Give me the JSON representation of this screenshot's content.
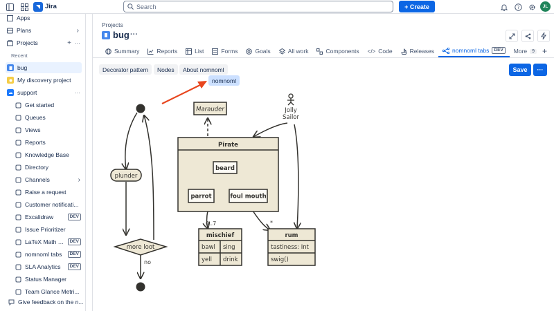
{
  "topbar": {
    "app_name": "Jira",
    "search_placeholder": "Search",
    "create_label": "+ Create",
    "avatar": "JL"
  },
  "sidebar": {
    "top": [
      {
        "label": "Apps"
      },
      {
        "label": "Plans"
      },
      {
        "label": "Projects"
      }
    ],
    "recent_label": "Recent",
    "recent": [
      {
        "label": "bug"
      },
      {
        "label": "My discovery project"
      },
      {
        "label": "support"
      }
    ],
    "items": [
      {
        "label": "Get started"
      },
      {
        "label": "Queues"
      },
      {
        "label": "Views"
      },
      {
        "label": "Reports"
      },
      {
        "label": "Knowledge Base"
      },
      {
        "label": "Directory"
      },
      {
        "label": "Channels"
      },
      {
        "label": "Raise a request"
      },
      {
        "label": "Customer notificati..."
      },
      {
        "label": "Excalidraw",
        "badge": "DEV"
      },
      {
        "label": "Issue Prioritizer"
      },
      {
        "label": "LaTeX Math T...",
        "badge": "DEV"
      },
      {
        "label": "nomnoml tabs",
        "badge": "DEV"
      },
      {
        "label": "SLA Analytics",
        "badge": "DEV"
      },
      {
        "label": "Status Manager"
      },
      {
        "label": "Team Glance Metri..."
      }
    ],
    "feedback": "Give feedback on the n..."
  },
  "header": {
    "breadcrumb": "Projects",
    "title": "bug",
    "more": "···"
  },
  "tabs": [
    {
      "label": "Summary"
    },
    {
      "label": "Reports"
    },
    {
      "label": "List"
    },
    {
      "label": "Forms"
    },
    {
      "label": "Goals"
    },
    {
      "label": "All work"
    },
    {
      "label": "Components"
    },
    {
      "label": "Code"
    },
    {
      "label": "Releases"
    },
    {
      "label": "nomnoml tabs",
      "badge": "DEV"
    },
    {
      "label": "More",
      "count": "9"
    }
  ],
  "subtabs": [
    {
      "label": "Decorator pattern"
    },
    {
      "label": "Nodes"
    },
    {
      "label": "About nomnoml"
    }
  ],
  "tooltip": "nomnoml",
  "toolbar": {
    "save_label": "Save",
    "more": "···"
  },
  "diagram": {
    "marauder": "Marauder",
    "jolly": "Jolly",
    "sailor": "Sailor",
    "pirate": "Pirate",
    "beard": "beard",
    "parrot": "parrot",
    "foul_mouth": "foul mouth",
    "plunder": "plunder",
    "more_loot": "more loot",
    "no": "no",
    "mischief": "mischief",
    "bawl": "bawl",
    "sing": "sing",
    "yell": "yell",
    "drink": "drink",
    "rum": "rum",
    "tastiness": "tastiness: Int",
    "swig": "swig()",
    "mult1": "0..7",
    "mult2": "*"
  }
}
